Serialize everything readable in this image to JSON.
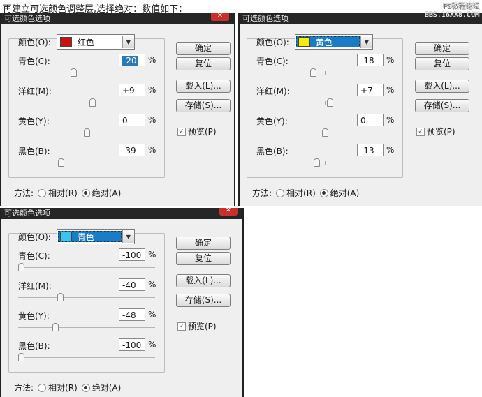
{
  "caption": "再建立可选颜色调整层,选择绝对：数值如下：",
  "watermark": {
    "line1": "PS教程论坛",
    "line2": "BBS.16XX8.COM"
  },
  "dialogs": [
    {
      "title": "可选颜色选项",
      "color_label": "颜色(O):",
      "color_value": "红色",
      "swatch": "#cc1111",
      "color_selected": false,
      "sliders": [
        {
          "label": "青色(C):",
          "value": "-20",
          "level": -20,
          "unit": "%"
        },
        {
          "label": "洋红(M):",
          "value": "+9",
          "level": 9,
          "unit": "%"
        },
        {
          "label": "黄色(Y):",
          "value": "0",
          "level": 0,
          "unit": "%"
        },
        {
          "label": "黑色(B):",
          "value": "-39",
          "level": -39,
          "unit": "%"
        }
      ],
      "buttons": {
        "ok": "确定",
        "reset": "复位",
        "load": "载入(L)...",
        "save": "存储(S)..."
      },
      "preview": {
        "label": "预览(P)",
        "checked": true
      },
      "method": {
        "label": "方法:",
        "relative": "相对(R)",
        "absolute": "绝对(A)",
        "selected": "absolute"
      }
    },
    {
      "title": "可选颜色选项",
      "color_label": "颜色(O):",
      "color_value": "黄色",
      "swatch": "#f5ee0a",
      "color_selected": true,
      "sliders": [
        {
          "label": "青色(C):",
          "value": "-18",
          "level": -18,
          "unit": "%"
        },
        {
          "label": "洋红(M):",
          "value": "+7",
          "level": 7,
          "unit": "%"
        },
        {
          "label": "黄色(Y):",
          "value": "0",
          "level": 0,
          "unit": "%"
        },
        {
          "label": "黑色(B):",
          "value": "-13",
          "level": -13,
          "unit": "%"
        }
      ],
      "buttons": {
        "ok": "确定",
        "reset": "复位",
        "load": "载入(L)...",
        "save": "存储(S)..."
      },
      "preview": {
        "label": "预览(P)",
        "checked": true
      },
      "method": {
        "label": "方法:",
        "relative": "相对(R)",
        "absolute": "绝对(A)",
        "selected": "absolute"
      }
    },
    {
      "title": "可选颜色选项",
      "color_label": "颜色(O):",
      "color_value": "青色",
      "swatch": "#3ec3f0",
      "color_selected": true,
      "sliders": [
        {
          "label": "青色(C):",
          "value": "-100",
          "level": -100,
          "unit": "%"
        },
        {
          "label": "洋红(M):",
          "value": "-40",
          "level": -40,
          "unit": "%"
        },
        {
          "label": "黄色(Y):",
          "value": "-48",
          "level": -48,
          "unit": "%"
        },
        {
          "label": "黑色(B):",
          "value": "-100",
          "level": -100,
          "unit": "%"
        }
      ],
      "buttons": {
        "ok": "确定",
        "reset": "复位",
        "load": "载入(L)...",
        "save": "存储(S)..."
      },
      "preview": {
        "label": "预览(P)",
        "checked": true
      },
      "method": {
        "label": "方法:",
        "relative": "相对(R)",
        "absolute": "绝对(A)",
        "selected": "absolute"
      }
    }
  ]
}
